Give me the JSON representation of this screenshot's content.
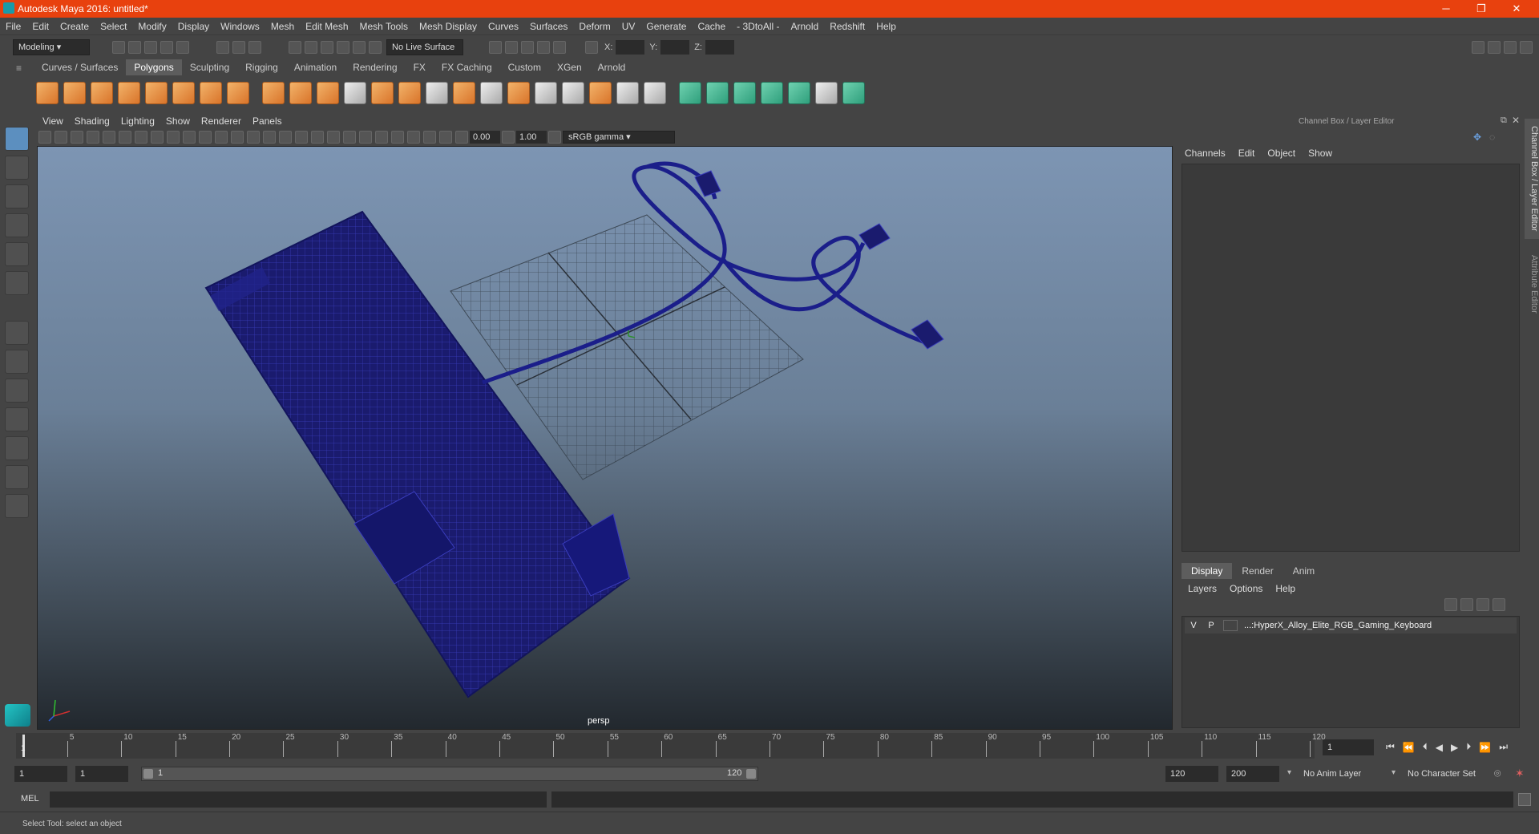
{
  "window": {
    "title": "Autodesk Maya 2016: untitled*",
    "min": "─",
    "restore": "❐",
    "close": "✕"
  },
  "menubar": [
    "File",
    "Edit",
    "Create",
    "Select",
    "Modify",
    "Display",
    "Windows",
    "Mesh",
    "Edit Mesh",
    "Mesh Tools",
    "Mesh Display",
    "Curves",
    "Surfaces",
    "Deform",
    "UV",
    "Generate",
    "Cache",
    "- 3DtoAll -",
    "Arnold",
    "Redshift",
    "Help"
  ],
  "toolbar": {
    "mode": "Modeling",
    "live_surface": "No Live Surface",
    "x_label": "X:",
    "y_label": "Y:",
    "z_label": "Z:"
  },
  "shelf_tabs": [
    "Curves / Surfaces",
    "Polygons",
    "Sculpting",
    "Rigging",
    "Animation",
    "Rendering",
    "FX",
    "FX Caching",
    "Custom",
    "XGen",
    "Arnold"
  ],
  "shelf_active": "Polygons",
  "viewport": {
    "menu": [
      "View",
      "Shading",
      "Lighting",
      "Show",
      "Renderer",
      "Panels"
    ],
    "exposure": "0.00",
    "gamma": "1.00",
    "color_space": "sRGB gamma",
    "camera": "persp"
  },
  "channel_box": {
    "title": "Channel Box / Layer Editor",
    "menu": [
      "Channels",
      "Edit",
      "Object",
      "Show"
    ]
  },
  "layer_editor": {
    "tabs": [
      "Display",
      "Render",
      "Anim"
    ],
    "active_tab": "Display",
    "menu": [
      "Layers",
      "Options",
      "Help"
    ],
    "layer": {
      "v": "V",
      "p": "P",
      "name": "...:HyperX_Alloy_Elite_RGB_Gaming_Keyboard"
    }
  },
  "side_tabs": {
    "channel": "Channel Box / Layer Editor",
    "attribute": "Attribute Editor"
  },
  "timeline": {
    "ticks": [
      "5",
      "10",
      "15",
      "20",
      "25",
      "30",
      "35",
      "40",
      "45",
      "50",
      "55",
      "60",
      "65",
      "70",
      "75",
      "80",
      "85",
      "90",
      "95",
      "100",
      "105",
      "110",
      "115",
      "120"
    ],
    "current_label": "1",
    "current_frame": "1"
  },
  "range": {
    "start": "1",
    "playback_start": "1",
    "slider_start": "1",
    "slider_end": "120",
    "playback_end": "120",
    "end": "200",
    "anim_layer": "No Anim Layer",
    "char_set": "No Character Set"
  },
  "mel": {
    "label": "MEL"
  },
  "status": {
    "help": "Select Tool: select an object"
  }
}
